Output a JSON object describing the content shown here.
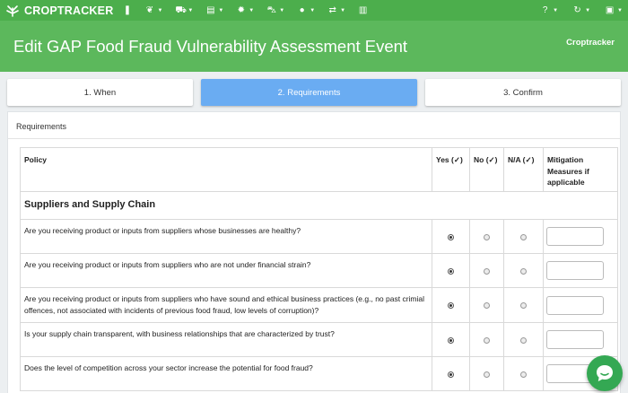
{
  "app": {
    "logo_text": "CROPTRACKER",
    "nav": [
      {
        "icon": "bookmark-icon",
        "glyph": "❚"
      },
      {
        "icon": "leaf-icon",
        "glyph": "❦"
      },
      {
        "icon": "cart-icon",
        "glyph": "⛟"
      },
      {
        "icon": "document-stack-icon",
        "glyph": "▤"
      },
      {
        "icon": "gear-icon",
        "glyph": "✹"
      },
      {
        "icon": "truck-icon",
        "glyph": "⛍"
      },
      {
        "icon": "user-icon",
        "glyph": "●"
      },
      {
        "icon": "exchange-icon",
        "glyph": "⇄"
      },
      {
        "icon": "bar-chart-icon",
        "glyph": "▥"
      }
    ],
    "nav_right": [
      {
        "icon": "help-icon",
        "glyph": "?"
      },
      {
        "icon": "refresh-icon",
        "glyph": "↻"
      },
      {
        "icon": "briefcase-icon",
        "glyph": "▣"
      }
    ]
  },
  "header": {
    "title": "Edit GAP Food Fraud Vulnerability Assessment Event",
    "organization": "Croptracker"
  },
  "steps": [
    "1. When",
    "2. Requirements",
    "3. Confirm"
  ],
  "active_step": 1,
  "panel": {
    "title": "Requirements",
    "columns": {
      "policy": "Policy",
      "yes": "Yes (✓)",
      "no": "No (✓)",
      "na": "N/A (✓)",
      "mitigation": "Mitigation Measures if applicable"
    },
    "section": "Suppliers and Supply Chain",
    "rows": [
      {
        "question": "Are you receiving product or inputs from suppliers whose businesses are healthy?",
        "selected": "yes",
        "mitigation": ""
      },
      {
        "question": "Are you receiving product or inputs from suppliers who are not under financial strain?",
        "selected": "yes",
        "mitigation": ""
      },
      {
        "question": "Are you receiving product or inputs from suppliers who have sound and ethical business practices (e.g., no past crimial offences, not associated with incidents of previous food fraud, low levels of corruption)?",
        "selected": "yes",
        "mitigation": ""
      },
      {
        "question": "Is your supply chain transparent, with business relationships that are characterized by trust?",
        "selected": "yes",
        "mitigation": ""
      },
      {
        "question": "Does the level of competition across your sector increase the potential for food fraud?",
        "selected": "yes",
        "mitigation": ""
      }
    ]
  },
  "colors": {
    "topbar": "#4cae4c",
    "header": "#5cb85c",
    "active_step": "#6aacf2",
    "chat_button": "#34a853"
  }
}
